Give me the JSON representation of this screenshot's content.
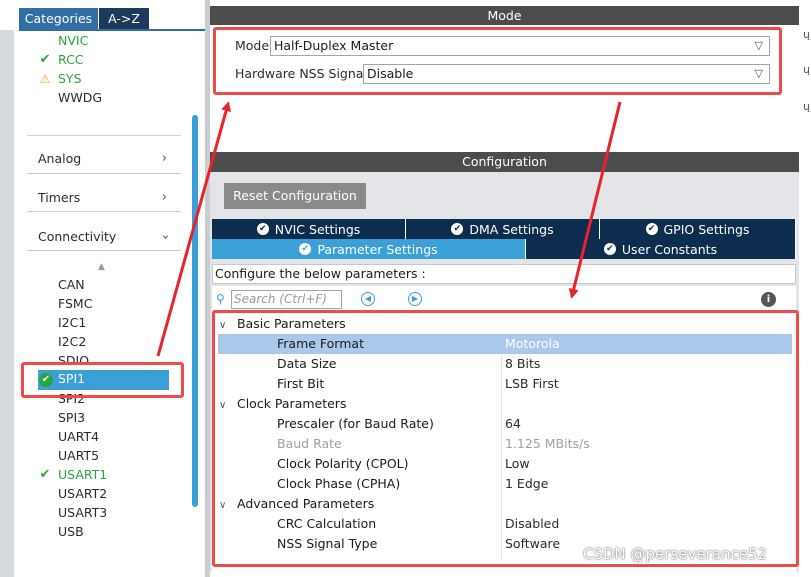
{
  "sidebar": {
    "tabs": {
      "categories": "Categories",
      "az": "A->Z"
    },
    "system_items": [
      {
        "label": "NVIC",
        "status": "enabled"
      },
      {
        "label": "RCC",
        "status": "ok"
      },
      {
        "label": "SYS",
        "status": "warning"
      },
      {
        "label": "WWDG",
        "status": "none"
      }
    ],
    "categories": [
      {
        "label": "Analog",
        "expanded": false
      },
      {
        "label": "Timers",
        "expanded": false
      },
      {
        "label": "Connectivity",
        "expanded": true
      }
    ],
    "connectivity_items": [
      {
        "label": "CAN",
        "status": "none"
      },
      {
        "label": "FSMC",
        "status": "none"
      },
      {
        "label": "I2C1",
        "status": "none"
      },
      {
        "label": "I2C2",
        "status": "none"
      },
      {
        "label": "SDIO",
        "status": "none"
      },
      {
        "label": "SPI1",
        "status": "selected-ok"
      },
      {
        "label": "SPI2",
        "status": "none"
      },
      {
        "label": "SPI3",
        "status": "none"
      },
      {
        "label": "UART4",
        "status": "none"
      },
      {
        "label": "UART5",
        "status": "none"
      },
      {
        "label": "USART1",
        "status": "ok"
      },
      {
        "label": "USART2",
        "status": "none"
      },
      {
        "label": "USART3",
        "status": "none"
      },
      {
        "label": "USB",
        "status": "none"
      }
    ]
  },
  "mode": {
    "header": "Mode",
    "mode_label": "Mode",
    "mode_value": "Half-Duplex Master",
    "nss_label": "Hardware NSS Signal",
    "nss_value": "Disable"
  },
  "configuration": {
    "header": "Configuration",
    "reset_button": "Reset Configuration",
    "tabs_row1": [
      {
        "label": "NVIC Settings"
      },
      {
        "label": "DMA Settings"
      },
      {
        "label": "GPIO Settings"
      }
    ],
    "tabs_row2": [
      {
        "label": "Parameter Settings",
        "active": true
      },
      {
        "label": "User Constants",
        "active": false
      }
    ],
    "configure_text": "Configure the below parameters :",
    "search_placeholder": "Search (Ctrl+F)",
    "groups": [
      {
        "name": "Basic Parameters",
        "params": [
          {
            "name": "Frame Format",
            "value": "Motorola",
            "selected": true
          },
          {
            "name": "Data Size",
            "value": "8 Bits"
          },
          {
            "name": "First Bit",
            "value": "LSB First"
          }
        ]
      },
      {
        "name": "Clock Parameters",
        "params": [
          {
            "name": "Prescaler (for Baud Rate)",
            "value": "64"
          },
          {
            "name": "Baud Rate",
            "value": "1.125 MBits/s",
            "disabled": true
          },
          {
            "name": "Clock Polarity (CPOL)",
            "value": "Low"
          },
          {
            "name": "Clock Phase (CPHA)",
            "value": "1 Edge"
          }
        ]
      },
      {
        "name": "Advanced Parameters",
        "params": [
          {
            "name": "CRC Calculation",
            "value": "Disabled"
          },
          {
            "name": "NSS Signal Type",
            "value": "Software"
          }
        ]
      }
    ]
  },
  "watermark": "CSDN @perseverance52",
  "colors": {
    "accent_blue": "#3b9fd8",
    "tab_navy": "#0d2d4f",
    "header_gray": "#4c4c4c",
    "annotation_red": "#ef4b4b",
    "status_green": "#2aa53a",
    "warning_yellow": "#e7b417"
  }
}
